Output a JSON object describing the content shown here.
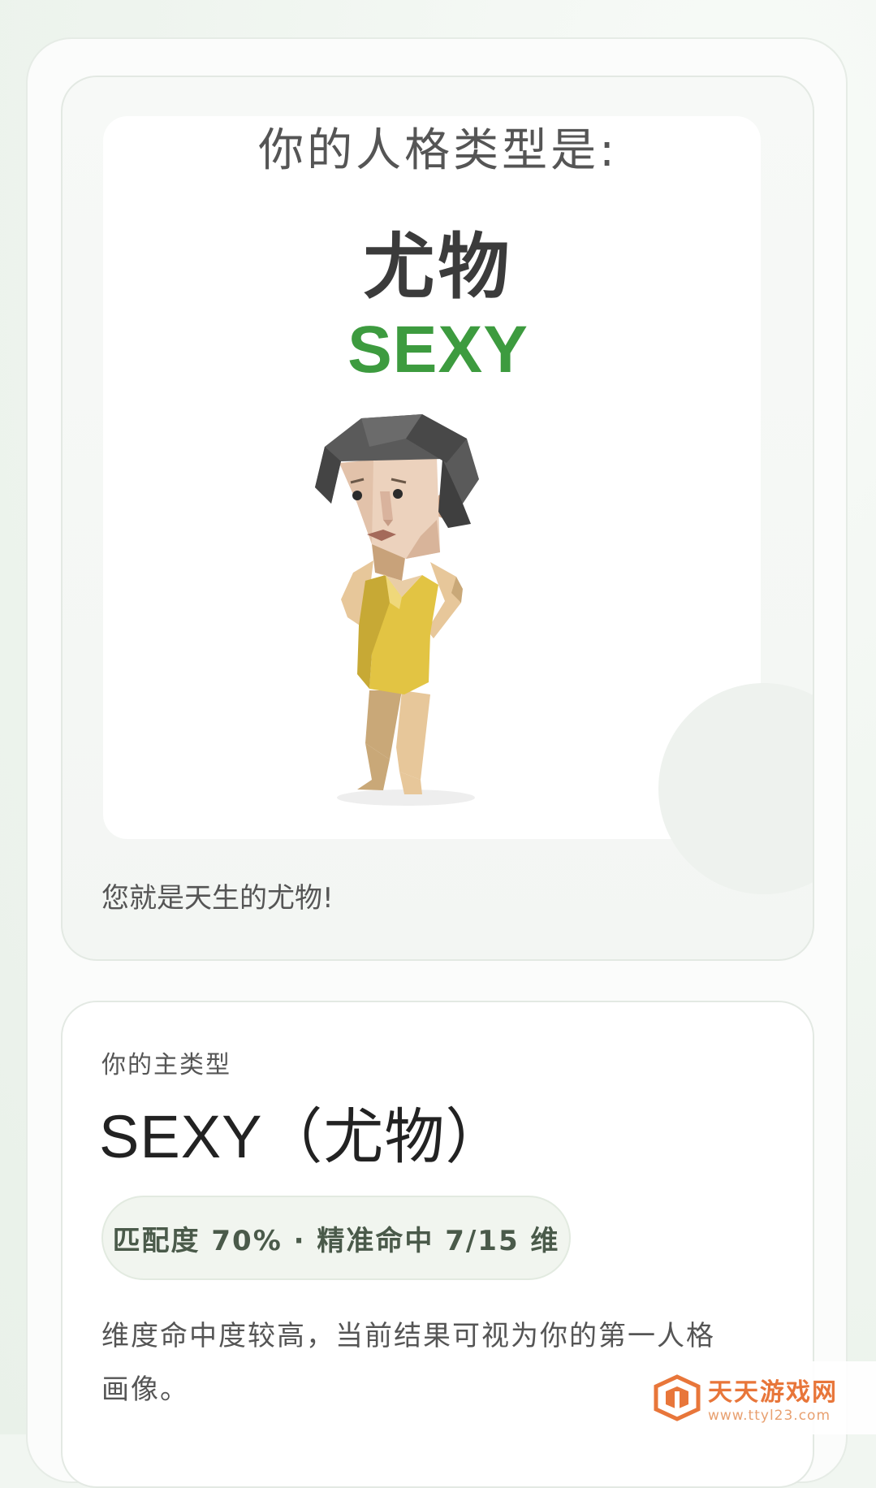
{
  "result": {
    "heading": "你的人格类型是:",
    "type_cn": "尤物",
    "type_en": "SEXY",
    "tagline": "您就是天生的尤物!",
    "character_icon": "low-poly-woman-illustration"
  },
  "main_type": {
    "label": "你的主类型",
    "value": "SEXY（尤物）",
    "match_text": "匹配度 70% · 精准命中 7/15 维",
    "match_percent": 70,
    "dims_hit": 7,
    "dims_total": 15,
    "description": "维度命中度较高，当前结果可视为你的第一人格画像。"
  },
  "watermark": {
    "name": "天天游戏网",
    "url": "www.ttyl23.com",
    "logo_icon": "ttyl-cube-logo"
  },
  "colors": {
    "accent_green": "#3d9b3f",
    "watermark_orange": "#e8763a"
  }
}
